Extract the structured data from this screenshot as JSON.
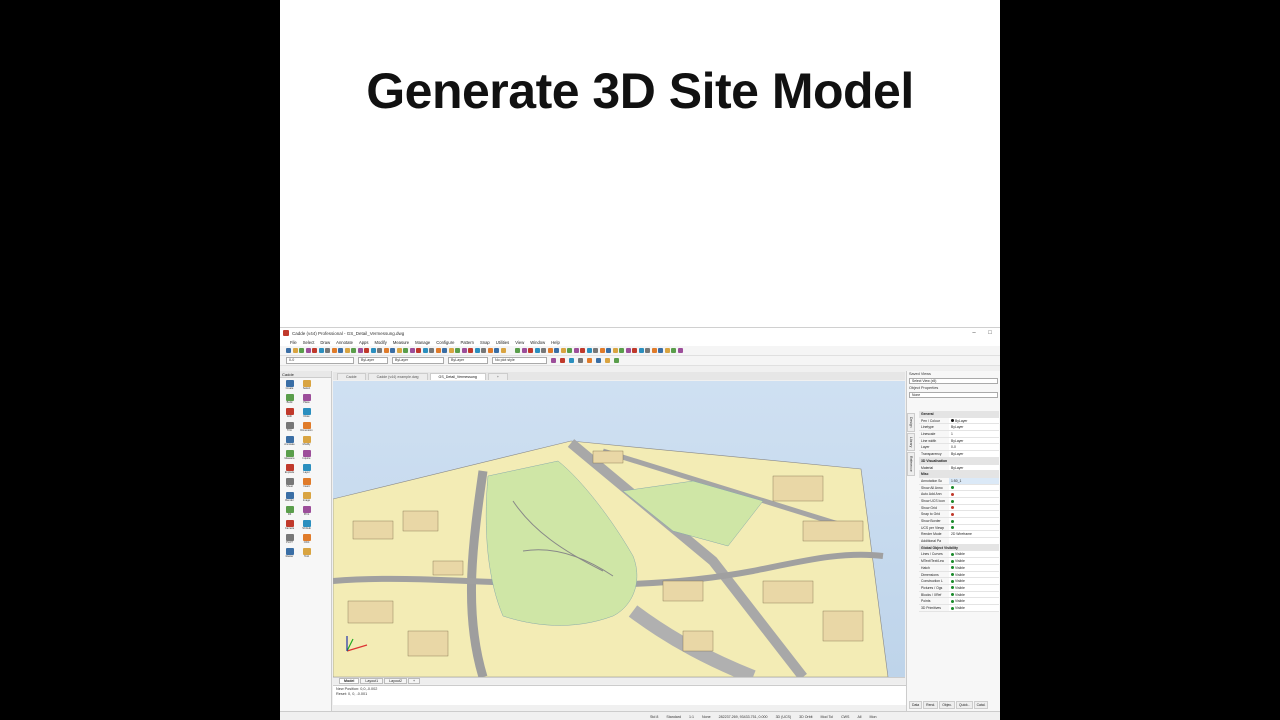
{
  "slide": {
    "title": "Generate 3D Site Model"
  },
  "app": {
    "window_title": "Cadde (v44) Professional - GS_Detail_Vermessung.dwg",
    "win_minimize": "–",
    "win_maximize": "□",
    "win_close": "×",
    "menu": [
      "File",
      "Select",
      "Draw",
      "Annotate",
      "Apps",
      "Modify",
      "Measure",
      "Manage",
      "Configure",
      "Pattern",
      "Snap",
      "Utilities",
      "View",
      "Window",
      "Help"
    ],
    "toolbar3": {
      "layer": "0-0",
      "colour": "ByLayer",
      "linetype": "ByLayer",
      "lineweight": "ByLayer",
      "plotstyle": "No plot style"
    },
    "toolbox": {
      "header": "Cadde",
      "tools": [
        "Create",
        "Select",
        "Build",
        "Place",
        "Edit",
        "Draw",
        "Trim",
        "Dimension",
        "Annotate",
        "Modify",
        "Measure",
        "Inquire",
        "Explode",
        "Layer",
        "Sheet",
        "Insert",
        "Render",
        "Image",
        "Fill",
        "Print",
        "Camera",
        "SCALE",
        "PLOT",
        "Orbit",
        "Raster",
        "Tool"
      ]
    },
    "doc_tabs": [
      "Cadde",
      "Cadde (v44) example.dwg",
      "GS_Detail_Vermessung",
      "+"
    ],
    "layout_tabs": [
      "Model",
      "Layout1",
      "Layout2",
      "+"
    ],
    "cmd_lines": [
      "New Position: 0,0,-0.002",
      "Reset: 0, 0, -0.001"
    ],
    "status": [
      "Std 8",
      "Standard",
      "1:1",
      "None",
      "282237.269, 93433.751, 0.000",
      "3D (UCS)",
      "3D Orbit",
      "Mod Tol",
      "CWS",
      "All",
      "Mon"
    ],
    "right": {
      "saved_views_title": "Saved Views",
      "saved_views_combo": "Select View (x5)",
      "object_props_title": "Object Properties",
      "object_props_combo": "None",
      "side_tabs": [
        "Design",
        "Library",
        "Reference"
      ],
      "props": [
        {
          "k": "General",
          "section": true
        },
        {
          "k": "Pen / Colour",
          "v": "ByLayer",
          "dot": "#111"
        },
        {
          "k": "Linetype",
          "v": "ByLayer"
        },
        {
          "k": "Linescale",
          "v": "1"
        },
        {
          "k": "Line width",
          "v": "ByLayer"
        },
        {
          "k": "Layer",
          "v": "0-0"
        },
        {
          "k": "Transparency",
          "v": "ByLayer"
        },
        {
          "k": "3D Visualisation",
          "section": true
        },
        {
          "k": "Material",
          "v": "ByLayer"
        },
        {
          "k": "Misc",
          "section": true
        },
        {
          "k": "Annotation Sc",
          "v": "1:50_1",
          "hl": true
        },
        {
          "k": "Show All Anno",
          "v": "",
          "dot": "#1a8a2a"
        },
        {
          "k": "Auto Add Ann",
          "v": "",
          "dot": "#c0392b"
        },
        {
          "k": "Show UCS Icon",
          "v": "",
          "dot": "#1a8a2a"
        },
        {
          "k": "Show Grid",
          "v": "",
          "dot": "#c0392b"
        },
        {
          "k": "Snap to Grid",
          "v": "",
          "dot": "#c0392b"
        },
        {
          "k": "Show Border",
          "v": "",
          "dot": "#1a8a2a"
        },
        {
          "k": "UCS per Viewp",
          "v": "",
          "dot": "#1a8a2a"
        },
        {
          "k": "Render Mode",
          "v": "2D Wireframe"
        },
        {
          "k": "Additional Pa",
          "v": ""
        },
        {
          "k": "Global Object Visibility",
          "section": true
        },
        {
          "k": "Lines / Curves",
          "v": "Visible",
          "dot": "#1a8a2a"
        },
        {
          "k": "MText/Text/Lea",
          "v": "Visible",
          "dot": "#1a8a2a"
        },
        {
          "k": "Hatch",
          "v": "Visible",
          "dot": "#1a8a2a"
        },
        {
          "k": "Dimensions",
          "v": "Visible",
          "dot": "#1a8a2a"
        },
        {
          "k": "Construction L",
          "v": "Visible",
          "dot": "#1a8a2a"
        },
        {
          "k": "Pictures / Ogs",
          "v": "Visible",
          "dot": "#1a8a2a"
        },
        {
          "k": "Blocks / XRef",
          "v": "Visible",
          "dot": "#1a8a2a"
        },
        {
          "k": "Points",
          "v": "Visible",
          "dot": "#1a8a2a"
        },
        {
          "k": "3D Primitives",
          "v": "Visible",
          "dot": "#1a8a2a"
        }
      ],
      "bottom_tabs": [
        "Data",
        "Rend.",
        "Objec.",
        "Quick..",
        "Catal."
      ]
    },
    "colors": {
      "map_yellow": "#f5efb8",
      "map_green": "#cfe7a8",
      "map_gray": "#bdbdbd",
      "sky": "#c7dcef"
    }
  }
}
